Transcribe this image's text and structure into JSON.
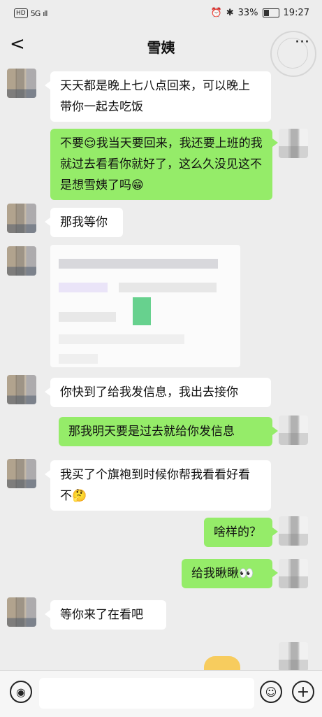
{
  "status": {
    "hd": "HD",
    "network": "5G",
    "signal_bars": "ıll",
    "battery_pct": "33%",
    "time": "19:27"
  },
  "nav": {
    "title": "雪姨",
    "back": "<",
    "more": "···"
  },
  "messages": [
    {
      "side": "left",
      "text": "天天都是晚上七八点回来，可以晚上带你一起去吃饭"
    },
    {
      "side": "right",
      "text": "不要😌我当天要回来，我还要上班的我就过去看看你就好了，这么久没见这不是想雪姨了吗😁"
    },
    {
      "side": "left",
      "text": "那我等你"
    },
    {
      "side": "left",
      "type": "image"
    },
    {
      "side": "left",
      "text": "你快到了给我发信息，我出去接你"
    },
    {
      "side": "right",
      "text": "那我明天要是过去就给你发信息"
    },
    {
      "side": "left",
      "text": "我买了个旗袍到时候你帮我看看好看不🤔"
    },
    {
      "side": "right",
      "text": "啥样的？"
    },
    {
      "side": "right",
      "text": "给我瞅瞅👀"
    },
    {
      "side": "left",
      "text": "等你来了在看吧"
    }
  ],
  "input": {
    "voice_icon": "voice-icon",
    "emoji_icon": "emoji-icon",
    "plus_icon": "plus-icon"
  }
}
